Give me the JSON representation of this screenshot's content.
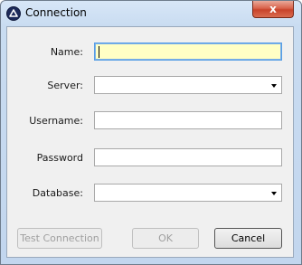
{
  "window": {
    "title": "Connection",
    "close_label": "x"
  },
  "form": {
    "name": {
      "label": "Name:",
      "value": ""
    },
    "server": {
      "label": "Server:",
      "value": ""
    },
    "username": {
      "label": "Username:",
      "value": ""
    },
    "password": {
      "label": "Password",
      "value": ""
    },
    "database": {
      "label": "Database:",
      "value": ""
    }
  },
  "buttons": {
    "test_connection": "Test Connection",
    "ok": "OK",
    "cancel": "Cancel"
  }
}
